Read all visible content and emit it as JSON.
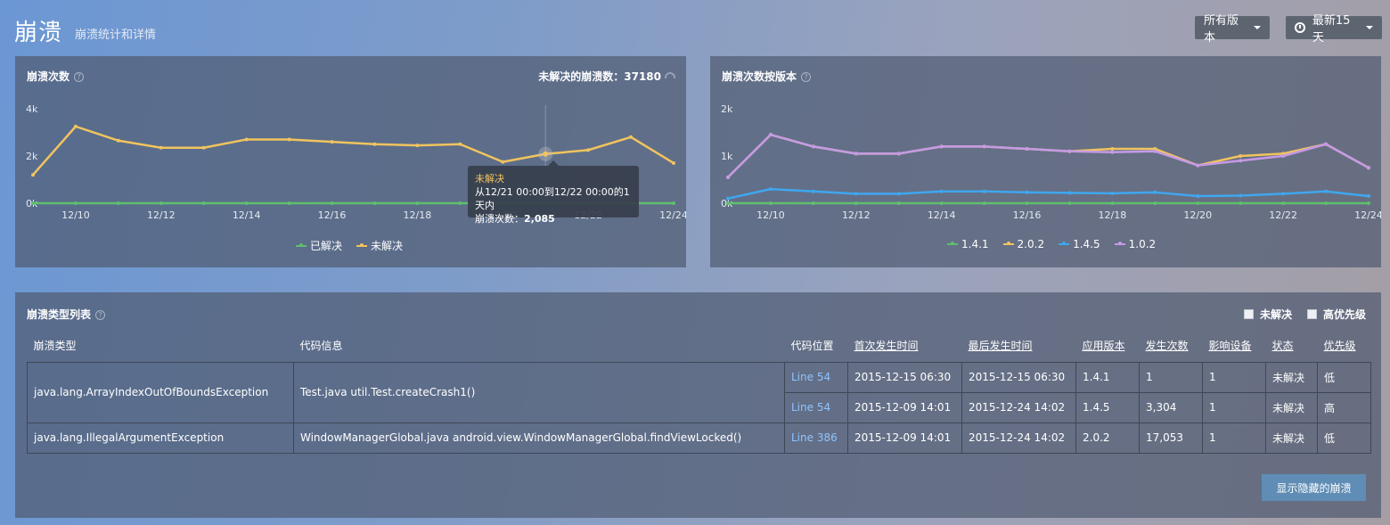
{
  "page": {
    "title": "崩溃",
    "subtitle": "崩溃统计和详情"
  },
  "header": {
    "version_filter": "所有版本",
    "time_filter": "最新15天"
  },
  "crash_count_panel": {
    "title": "崩溃次数",
    "unresolved_label": "未解决的崩溃数：",
    "unresolved_value": "37180",
    "tooltip": {
      "title": "未解决",
      "range": "从12/21 00:00到12/22 00:00的1天内",
      "count_label": "崩溃次数：",
      "count_value": "2,085"
    },
    "legend": [
      {
        "name": "已解决",
        "color": "#5fbf6d"
      },
      {
        "name": "未解决",
        "color": "#f0c45e"
      }
    ]
  },
  "version_panel": {
    "title": "崩溃次数按版本",
    "legend": [
      {
        "name": "1.4.1",
        "color": "#5fbf6d"
      },
      {
        "name": "2.0.2",
        "color": "#f0c45e"
      },
      {
        "name": "1.4.5",
        "color": "#3fa7ef"
      },
      {
        "name": "1.0.2",
        "color": "#c59ae6"
      }
    ]
  },
  "chart_data": [
    {
      "type": "line",
      "title": "崩溃次数",
      "x_ticks": [
        "12/10",
        "12/12",
        "12/14",
        "12/16",
        "12/18",
        "12/20",
        "12/22",
        "12/24"
      ],
      "y_ticks": [
        "0k",
        "2k",
        "4k"
      ],
      "ylim": [
        0,
        4000
      ],
      "x": [
        "12/09",
        "12/10",
        "12/11",
        "12/12",
        "12/13",
        "12/14",
        "12/15",
        "12/16",
        "12/17",
        "12/18",
        "12/19",
        "12/20",
        "12/21",
        "12/22",
        "12/23",
        "12/24"
      ],
      "series": [
        {
          "name": "已解决",
          "color": "#5fbf6d",
          "values": [
            0,
            0,
            0,
            0,
            0,
            0,
            0,
            0,
            0,
            0,
            0,
            0,
            0,
            0,
            0,
            0
          ]
        },
        {
          "name": "未解决",
          "color": "#f0c45e",
          "values": [
            1200,
            3250,
            2650,
            2350,
            2350,
            2700,
            2700,
            2600,
            2500,
            2450,
            2500,
            1750,
            2085,
            2250,
            2800,
            1700
          ]
        }
      ],
      "grid": false
    },
    {
      "type": "line",
      "title": "崩溃次数按版本",
      "x_ticks": [
        "12/10",
        "12/12",
        "12/14",
        "12/16",
        "12/18",
        "12/20",
        "12/22",
        "12/24"
      ],
      "y_ticks": [
        "0k",
        "1k",
        "2k"
      ],
      "ylim": [
        0,
        2000
      ],
      "x": [
        "12/09",
        "12/10",
        "12/11",
        "12/12",
        "12/13",
        "12/14",
        "12/15",
        "12/16",
        "12/17",
        "12/18",
        "12/19",
        "12/20",
        "12/21",
        "12/22",
        "12/23",
        "12/24"
      ],
      "series": [
        {
          "name": "1.4.1",
          "color": "#5fbf6d",
          "values": [
            0,
            0,
            0,
            0,
            0,
            0,
            0,
            0,
            0,
            0,
            0,
            0,
            0,
            0,
            0,
            0
          ]
        },
        {
          "name": "2.0.2",
          "color": "#f0c45e",
          "values": [
            550,
            1450,
            1200,
            1050,
            1050,
            1200,
            1200,
            1150,
            1100,
            1150,
            1150,
            800,
            1000,
            1050,
            1250,
            750
          ]
        },
        {
          "name": "1.4.5",
          "color": "#3fa7ef",
          "values": [
            100,
            300,
            250,
            200,
            200,
            250,
            250,
            230,
            220,
            210,
            230,
            150,
            160,
            200,
            250,
            150
          ]
        },
        {
          "name": "1.0.2",
          "color": "#c59ae6",
          "values": [
            550,
            1450,
            1200,
            1050,
            1050,
            1200,
            1200,
            1150,
            1100,
            1080,
            1100,
            800,
            900,
            1000,
            1250,
            750
          ]
        }
      ],
      "grid": false
    }
  ],
  "crash_list": {
    "title": "崩溃类型列表",
    "filters": {
      "unresolved": "未解决",
      "high_priority": "高优先级"
    },
    "columns": [
      "崩溃类型",
      "代码信息",
      "代码位置",
      "首次发生时间",
      "最后发生时间",
      "应用版本",
      "发生次数",
      "影响设备",
      "状态",
      "优先级"
    ],
    "groups": [
      {
        "type": "java.lang.ArrayIndexOutOfBoundsException",
        "code_info": "Test.java util.Test.createCrash1()",
        "rows": [
          {
            "location": "Line 54",
            "first": "2015-12-15 06:30",
            "last": "2015-12-15 06:30",
            "version": "1.4.1",
            "count": "1",
            "devices": "1",
            "status": "未解决",
            "priority": "低"
          },
          {
            "location": "Line 54",
            "first": "2015-12-09 14:01",
            "last": "2015-12-24 14:02",
            "version": "1.4.5",
            "count": "3,304",
            "devices": "1",
            "status": "未解决",
            "priority": "高"
          }
        ]
      },
      {
        "type": "java.lang.IllegalArgumentException",
        "code_info": "WindowManagerGlobal.java android.view.WindowManagerGlobal.findViewLocked()",
        "rows": [
          {
            "location": "Line 386",
            "first": "2015-12-09 14:01",
            "last": "2015-12-24 14:02",
            "version": "2.0.2",
            "count": "17,053",
            "devices": "1",
            "status": "未解决",
            "priority": "低"
          }
        ]
      }
    ],
    "show_hidden_label": "显示隐藏的崩溃"
  }
}
